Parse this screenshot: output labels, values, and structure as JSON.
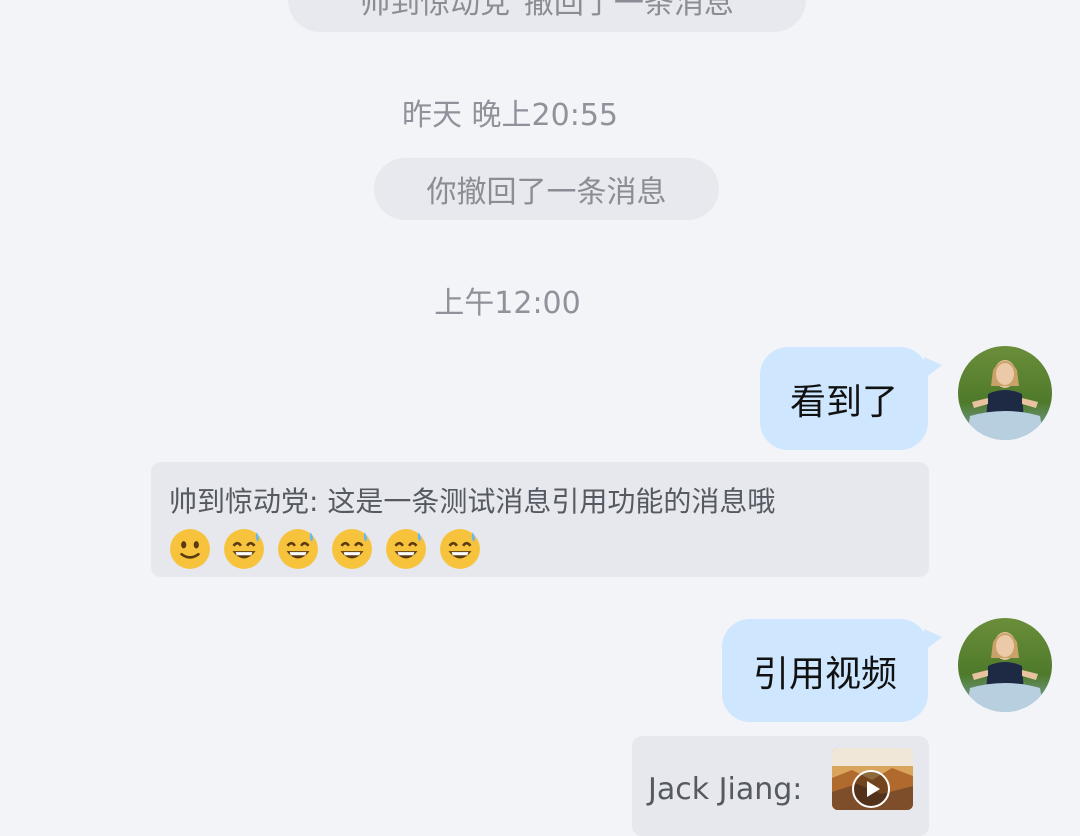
{
  "messages": {
    "top_system_notice": "帅到惊动党\"撤回了一条消息",
    "yesterday_time": "昨天 晚上20:55",
    "you_recalled_notice": "你撤回了一条消息",
    "noon_time": "上午12:00",
    "outgoing_1": "看到了",
    "quote_1_text": "帅到惊动党: 这是一条测试消息引用功能的消息哦",
    "quote_1_emojis": [
      "slightly-smiling-face-icon",
      "grinning-sweat-face-icon",
      "grinning-sweat-face-icon",
      "grinning-sweat-face-icon",
      "grinning-sweat-face-icon",
      "grinning-sweat-face-icon"
    ],
    "outgoing_2": "引用视频",
    "quote_2_sender": "Jack Jiang:"
  },
  "colors": {
    "background": "#f3f4f8",
    "outgoing_bubble": "#cfe6ff",
    "system_pill": "#e8e9ee",
    "quote_card": "#e7e8ed"
  }
}
